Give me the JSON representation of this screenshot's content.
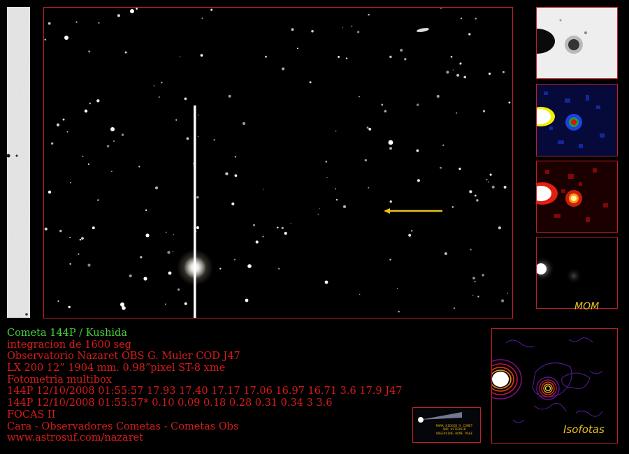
{
  "info": {
    "lines": [
      "Cometa 144P / Kushida",
      "integracion de 1600 seg",
      "Observatorio Nazaret  OBS G. Muler   COD J47",
      "LX 200 12” 1904 mm. 0.98”pixel ST-8 xme",
      "Fotometria multibox",
      "144P 12/10/2008 01:55:57 17.93 17.40 17.17 17.06 16.97 16.71 3.6 17.9 J47",
      "144P 12/10/2008 01:55:57* 0.10 0.09 0.18 0.28 0.31 0.34 3 3.6",
      "FOCAS II",
      "Cara - Observadores Cometas - Cometas Obs",
      "www.astrosuf.com/nazaret"
    ]
  },
  "labels": {
    "mom": "MOM",
    "isofotas": "Isofotas"
  },
  "logo": {
    "line1": "MARK KIDGER'S COMET",
    "line2": "AND ASTEROID",
    "line3": "OBSERVING HOME PAGE"
  },
  "colors": {
    "frame": "#c0202a",
    "info_text": "#d81b1b",
    "title_text": "#46d13a",
    "arrow": "#e8c21e",
    "label": "#e8c21e"
  }
}
